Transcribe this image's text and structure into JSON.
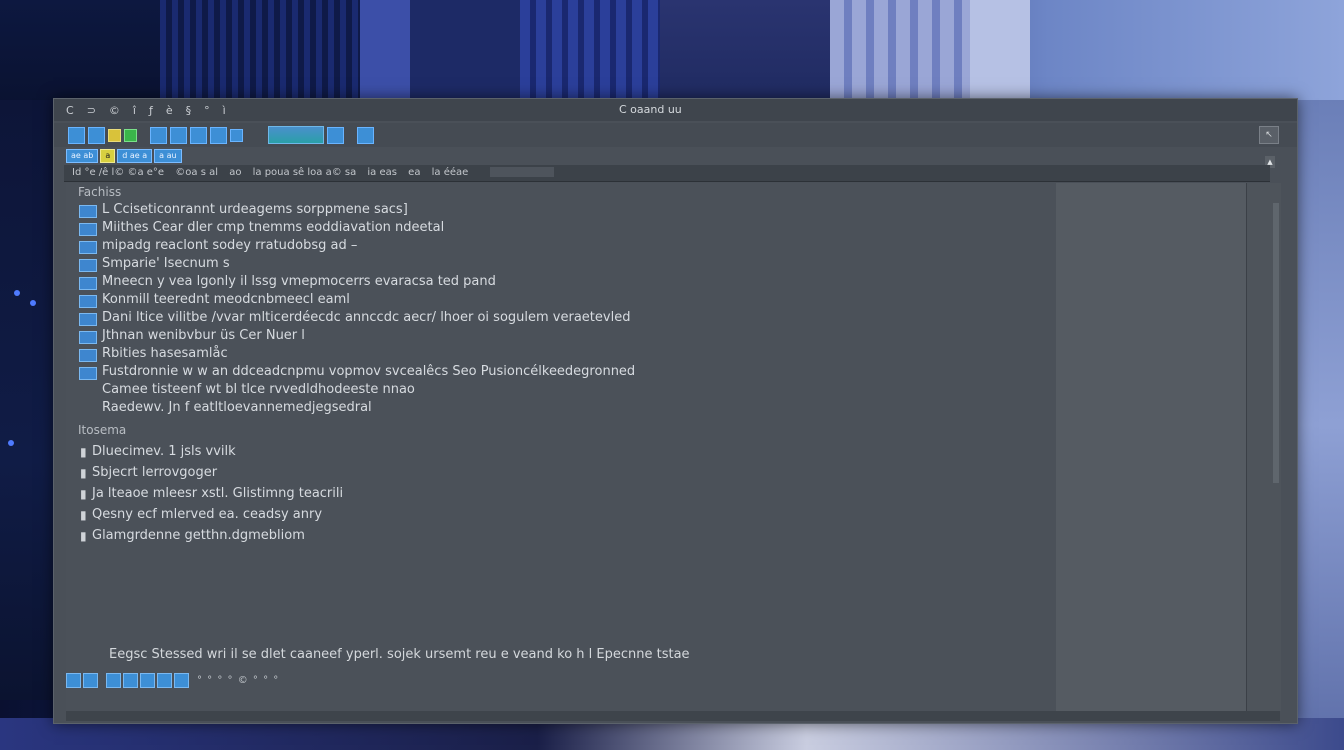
{
  "window": {
    "title": "C oaand uu",
    "menu": [
      "C",
      "⊃",
      "©",
      "î",
      "ƒ",
      "è",
      "§",
      "°",
      "ì"
    ],
    "corner_button": "↖"
  },
  "tabs": [
    {
      "label": "ae ab"
    },
    {
      "label": "a"
    },
    {
      "label": "d ae a"
    },
    {
      "label": "a au"
    }
  ],
  "pathbar": {
    "segments": [
      "Id  °e  /ê  l©  ©a  e°e",
      "©oa s  al",
      "ao",
      "la  poua  sê loa a© sa",
      "ia  eas",
      "ea",
      "la  ééae"
    ]
  },
  "section1": {
    "heading": "Fachiss",
    "lines": [
      "L Cciseticonrannt urdeagems sorppmene sacs]",
      "Miithes  Cear dler  cmp tnemms  eoddiavation  ndeetal",
      "mipadg reaclont sodey rratudobsg ad –",
      "Smparie'   Isecnum  s",
      "Mneecn  y  vea lgonly   il lssg   vmepmocerrs evaracsa  ted  pand",
      "Konmill   teerednt  meodcnbmeecl  eaml",
      "Dani ltice vilitbe  /vvar mlticerdéecdc annccdc aecr/ lhoer  oi  sogulem  veraetevled",
      "Jthnan  wenibvbur  üs  Cer Nuer  l",
      "Rbities   hasesamlåc",
      "Fustdronnie w w an  ddceadcnpmu vopmov svcealêcs  Seo  Pusioncélkeedegronned",
      "Camee  tisteenf  wt  bl tlce  rvvedldhodeeste  nnao",
      "Raedewv.  Jn  f eatltloevannemedjegsedral"
    ]
  },
  "section2": {
    "heading": "Itosema",
    "lines": [
      "Dluecimev.  1 jsls  vvilk",
      "Sbjecrt lerrovgoger",
      "Ja lteaoe  mleesr  xstl.  Glistimng teacrili",
      "Qesny  ecf mlerved  ea.  ceadsy   anry",
      "Glamgrdenne  getthn.dgmebliom"
    ]
  },
  "status": {
    "text": "Eegsc  Stessed  wri  il  se dlet  caaneef  yperl.   sojek ursemt  reu e  veand  ko  h  l   Epecnne  tstae"
  },
  "bottombar": {
    "label": "°    °  °  °  ©   °  °  °"
  }
}
